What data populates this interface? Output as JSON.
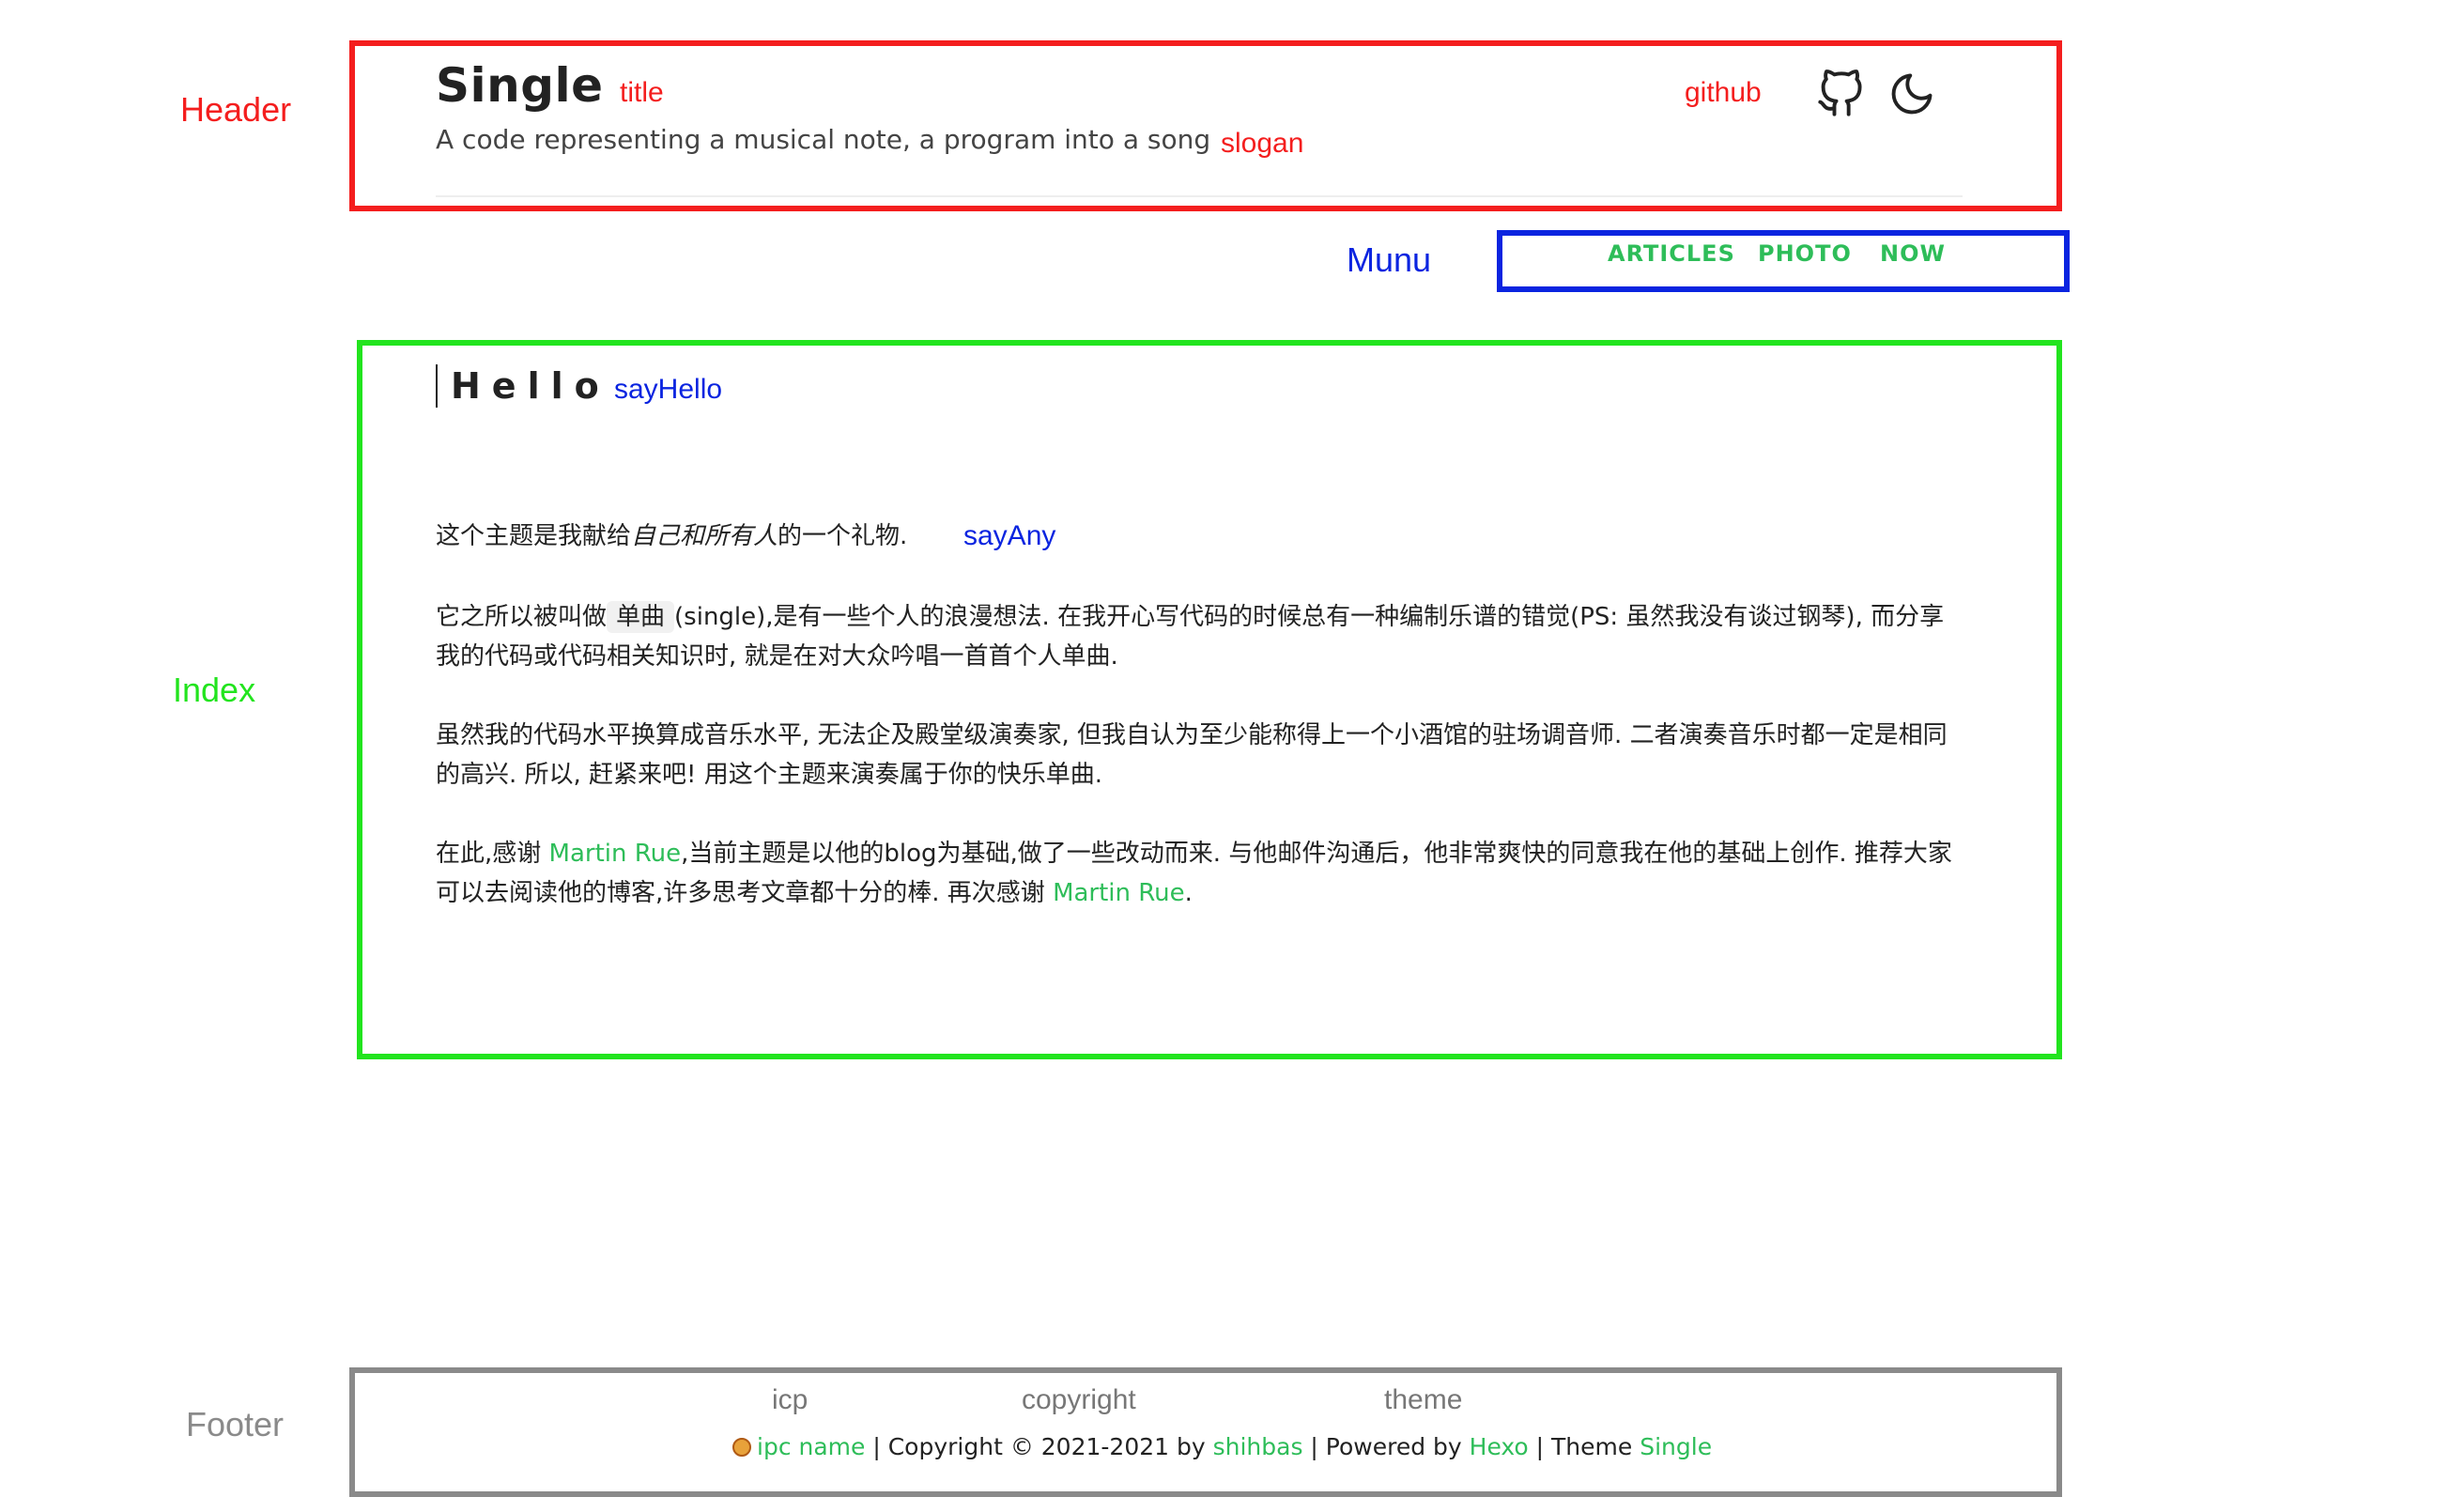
{
  "annotations": {
    "header": "Header",
    "menu": "Munu",
    "index": "Index",
    "footer": "Footer",
    "title": "title",
    "slogan": "slogan",
    "github": "github",
    "say_hello": "sayHello",
    "say_any": "sayAny",
    "icp": "icp",
    "copyright": "copyright",
    "theme": "theme"
  },
  "header": {
    "title": "Single",
    "slogan": "A code representing a musical note, a program into a song"
  },
  "icons": {
    "github": "github-icon",
    "dark_mode": "moon-icon"
  },
  "menu": {
    "items": [
      "ARTICLES",
      "PHOTO",
      "NOW"
    ]
  },
  "index": {
    "hello": "Hello",
    "p1_a": "这个主题是我献给",
    "p1_em": "自己和所有人",
    "p1_b": "的一个礼物.",
    "p2_a": "它之所以被叫做",
    "p2_code": "单曲",
    "p2_b": "(single),是有一些个人的浪漫想法. 在我开心写代码的时候总有一种编制乐谱的错觉(PS: 虽然我没有谈过钢琴), 而分享我的代码或代码相关知识时, 就是在对大众吟唱一首首个人单曲.",
    "p3": "虽然我的代码水平换算成音乐水平, 无法企及殿堂级演奏家, 但我自认为至少能称得上一个小酒馆的驻场调音师. 二者演奏音乐时都一定是相同的高兴. 所以, 赶紧来吧! 用这个主题来演奏属于你的快乐单曲.",
    "p4_a": "在此,感谢 ",
    "p4_link1": "Martin Rue",
    "p4_b": ",当前主题是以他的blog为基础,做了一些改动而来. 与他邮件沟通后，他非常爽快的同意我在他的基础上创作. 推荐大家可以去阅读他的博客,许多思考文章都十分的棒. 再次感谢 ",
    "p4_link2": "Martin Rue",
    "p4_c": "."
  },
  "footer": {
    "ipc_name": "ipc name",
    "copyright_text": " | Copyright © 2021-2021 by ",
    "author": "shihbas",
    "powered_text": " | Powered by ",
    "hexo": "Hexo",
    "theme_text": " | Theme ",
    "theme_name": "Single"
  },
  "colors": {
    "header_box": "#f41e1e",
    "menu_box": "#0a24e0",
    "index_box": "#22e41e",
    "footer_box": "#8a8a8a",
    "link": "#2ebd59"
  }
}
